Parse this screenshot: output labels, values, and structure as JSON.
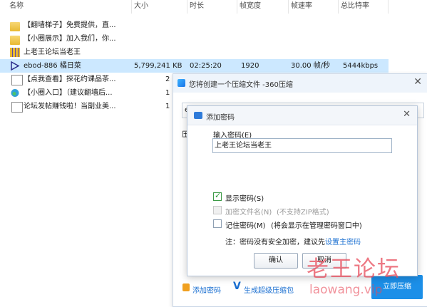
{
  "columns": [
    "名称",
    "大小",
    "时长",
    "帧宽度",
    "帧速率",
    "总比特率"
  ],
  "files": [
    {
      "icon": "folder-icon",
      "name": "【翻墙梯子】免费提供，直...",
      "size": "",
      "duration": "",
      "width": "",
      "fps": "",
      "bitrate": ""
    },
    {
      "icon": "folder-icon",
      "name": "【小圈展示】加入我们，你...",
      "size": "",
      "duration": "",
      "width": "",
      "fps": "",
      "bitrate": ""
    },
    {
      "icon": "zip-icon",
      "name": "上老王论坛当老王",
      "size": "",
      "duration": "",
      "width": "",
      "fps": "",
      "bitrate": ""
    },
    {
      "icon": "video-icon",
      "name": "ebod-886 橘日菜",
      "size": "5,799,241 KB",
      "duration": "02:25:20",
      "width": "1920",
      "fps": "30.00 帧/秒",
      "bitrate": "5444kbps"
    },
    {
      "icon": "document-icon",
      "name": "【点我查看】探花约课品茶...",
      "size": "2",
      "duration": "",
      "width": "",
      "fps": "",
      "bitrate": ""
    },
    {
      "icon": "edge-icon",
      "name": "【小圈入口】（建议翻墙后...",
      "size": "1",
      "duration": "",
      "width": "",
      "fps": "",
      "bitrate": ""
    },
    {
      "icon": "document-icon",
      "name": "论坛发帖赚钱啦！当副业美...",
      "size": "1",
      "duration": "",
      "width": "",
      "fps": "",
      "bitrate": ""
    }
  ],
  "dialog360": {
    "title": "您将创建一个压缩文件 -360压缩",
    "close": "✕",
    "field_prefix": "e",
    "label_prefix": "压",
    "add_password_link": "添加密码",
    "super_zip_link": "生成超级压缩包",
    "primary_button": "立即压缩"
  },
  "password_dialog": {
    "title": "添加密码",
    "close": "✕",
    "input_label": "输入密码(E)",
    "password_value": "上老王论坛当老王",
    "show_password": {
      "label": "显示密码(S)",
      "checked": true
    },
    "encrypt_filename": {
      "label": "加密文件名(N)",
      "note": "(不支持ZIP格式)",
      "enabled": false
    },
    "remember_password": {
      "label": "记住密码(M)",
      "note": "(将会显示在管理密码窗口中)",
      "checked": false
    },
    "hint": "注：密码没有安全加密，建议先",
    "hint_link": "设置主密码",
    "ok": "确认",
    "cancel": "取消"
  },
  "watermark": {
    "main": "老王论坛",
    "sub": "laowang.vip"
  }
}
